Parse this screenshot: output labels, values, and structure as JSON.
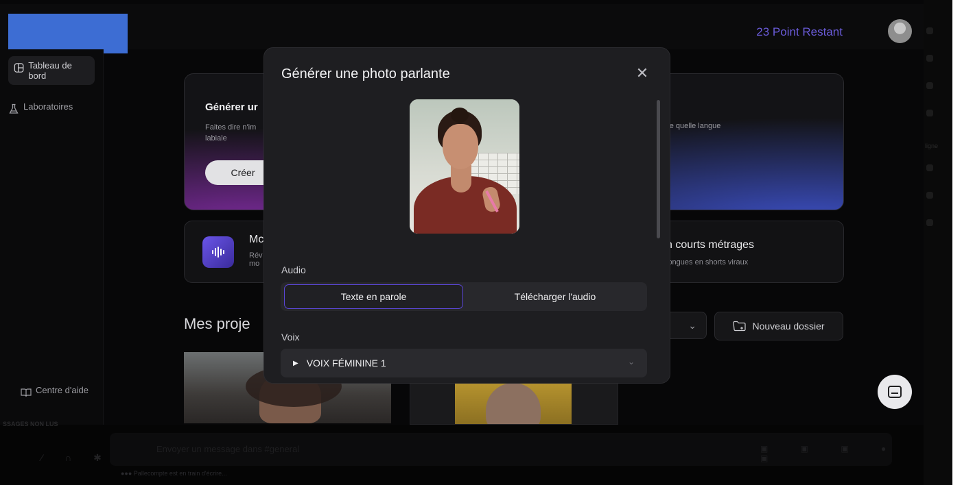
{
  "header": {
    "points_label": "23 Point Restant"
  },
  "sidebar": {
    "items": [
      {
        "label": "Tableau de bord",
        "icon": "dashboard-icon",
        "active": true
      },
      {
        "label": "Laboratoires",
        "icon": "flask-icon",
        "active": false
      }
    ],
    "help_label": "Centre d'aide"
  },
  "background": {
    "card1_title": "Générer ur",
    "card1_desc": "Faites dire n'im labiale",
    "card1_desc_right": "rte quelle langue",
    "card1_button": "Créer",
    "card2_title": "Mc",
    "card2_desc": "Rév mo",
    "card3_title": "n courts métrages",
    "card3_desc": "longues en shorts viraux",
    "projects_title": "Mes proje",
    "new_folder_label": "Nouveau dossier"
  },
  "modal": {
    "title": "Générer une photo parlante",
    "audio_label": "Audio",
    "audio_tabs": [
      {
        "label": "Texte en parole",
        "active": true
      },
      {
        "label": "Télécharger l'audio",
        "active": false
      }
    ],
    "voice_label": "Voix",
    "voice_value": "VOIX FÉMININE 1"
  },
  "bottom": {
    "unread_label": "SSAGES NON LUS",
    "message_placeholder": "Envoyer un message dans #general",
    "typing_label": "●●● Pallecompte est en train d'écrire..."
  },
  "side_strip": {
    "text": "ligne"
  },
  "colors": {
    "accent": "#5b46d6",
    "points": "#6a5bd9",
    "logo_block": "#3d6dd3",
    "modal_bg": "#1e1e21"
  }
}
